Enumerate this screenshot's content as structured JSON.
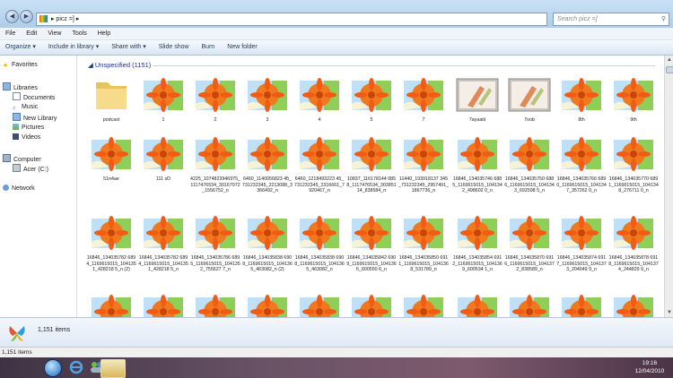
{
  "window": {
    "address": "picz =]",
    "search_placeholder": "Search picz =]"
  },
  "menu": [
    "File",
    "Edit",
    "View",
    "Tools",
    "Help"
  ],
  "toolbar": [
    "Organize ▾",
    "Include in library ▾",
    "Share with ▾",
    "Slide show",
    "Burn",
    "New folder"
  ],
  "nav": {
    "favorites": "Favorites",
    "libraries": "Libraries",
    "library_items": [
      "Documents",
      "Music",
      "New Library",
      "Pictures",
      "Videos"
    ],
    "computer": "Computer",
    "drive": "Acer (C:)",
    "network": "Network"
  },
  "group_header": "Unspecified (1151)",
  "files": [
    {
      "name": "podcast",
      "kind": "folder"
    },
    {
      "name": "1",
      "kind": "img"
    },
    {
      "name": "2",
      "kind": "img"
    },
    {
      "name": "3",
      "kind": "img"
    },
    {
      "name": "4",
      "kind": "img"
    },
    {
      "name": "5",
      "kind": "img"
    },
    {
      "name": "7",
      "kind": "img"
    },
    {
      "name": "7ayaatii",
      "kind": "paint"
    },
    {
      "name": "7oob",
      "kind": "paint"
    },
    {
      "name": "8th",
      "kind": "img"
    },
    {
      "name": "9th",
      "kind": "img"
    },
    {
      "name": "51n4ae",
      "kind": "img"
    },
    {
      "name": "111 xD",
      "kind": "img"
    },
    {
      "name": "4225_1074823946975_1117476534_30167072_1556752_n",
      "kind": "img"
    },
    {
      "name": "6460_1140056823 45_731232345_2213088_3366492_n",
      "kind": "img"
    },
    {
      "name": "6460_1218493223 45_731232345_2316661_7920467_n",
      "kind": "img"
    },
    {
      "name": "10837_116178144 0858_1117476534_30385114_838584_n",
      "kind": "img"
    },
    {
      "name": "11440_193918137 345_731232345_2957491_1867736_n",
      "kind": "img"
    },
    {
      "name": "16846_134035746 6885_1169615015_1041342_498602 0_n",
      "kind": "img"
    },
    {
      "name": "16846_134035750 6886_1169615015_1041343_692598 5_n",
      "kind": "img"
    },
    {
      "name": "16846_134035766 6890_1169615015_1041347_357262 0_n",
      "kind": "img"
    },
    {
      "name": "16846_134035770 6891_1169615015_1041348_276711 0_n",
      "kind": "img"
    },
    {
      "name": "16846_134035782 6894_1169615015_1041351_428218 5_n (2)",
      "kind": "img"
    },
    {
      "name": "16846_134035782 6894_1169615015_1041351_428218 5_n",
      "kind": "img"
    },
    {
      "name": "16846_134035786 6895_1169615015_1041352_755627 7_n",
      "kind": "img"
    },
    {
      "name": "16846_134035838 6908_1169615015_1041365_463082_n (2)",
      "kind": "img"
    },
    {
      "name": "16846_134035838 6908_1169615015_1041365_463082_n",
      "kind": "img"
    },
    {
      "name": "16846_134035842 6909_1169615015_1041366_600550 6_n",
      "kind": "img"
    },
    {
      "name": "16846_134035850 6911_1169615015_1041368_531789_n",
      "kind": "img"
    },
    {
      "name": "16846_134035854 6912_1169615015_1041369_600534 1_n",
      "kind": "img"
    },
    {
      "name": "16846_134035870 6916_1169615015_1041372_838589_n",
      "kind": "img"
    },
    {
      "name": "16846_134035874 6917_1169615015_1041373_204049 9_n",
      "kind": "img"
    },
    {
      "name": "16846_134035878 6918_1169615015_1041374_244829 9_n",
      "kind": "img"
    },
    {
      "name": "",
      "kind": "img"
    },
    {
      "name": "",
      "kind": "img"
    },
    {
      "name": "",
      "kind": "img"
    },
    {
      "name": "",
      "kind": "img"
    },
    {
      "name": "",
      "kind": "img"
    },
    {
      "name": "",
      "kind": "img"
    },
    {
      "name": "",
      "kind": "img"
    },
    {
      "name": "",
      "kind": "img"
    },
    {
      "name": "",
      "kind": "img"
    },
    {
      "name": "",
      "kind": "img"
    },
    {
      "name": "",
      "kind": "img"
    }
  ],
  "details_count": "1,151 items",
  "status": "1,151 items",
  "clock": {
    "time": "19:16",
    "date": "12/04/2010"
  },
  "colors": {
    "accent": "#1e3287",
    "titlebar": "#bcd7f0",
    "flower": "#f05a1a"
  }
}
